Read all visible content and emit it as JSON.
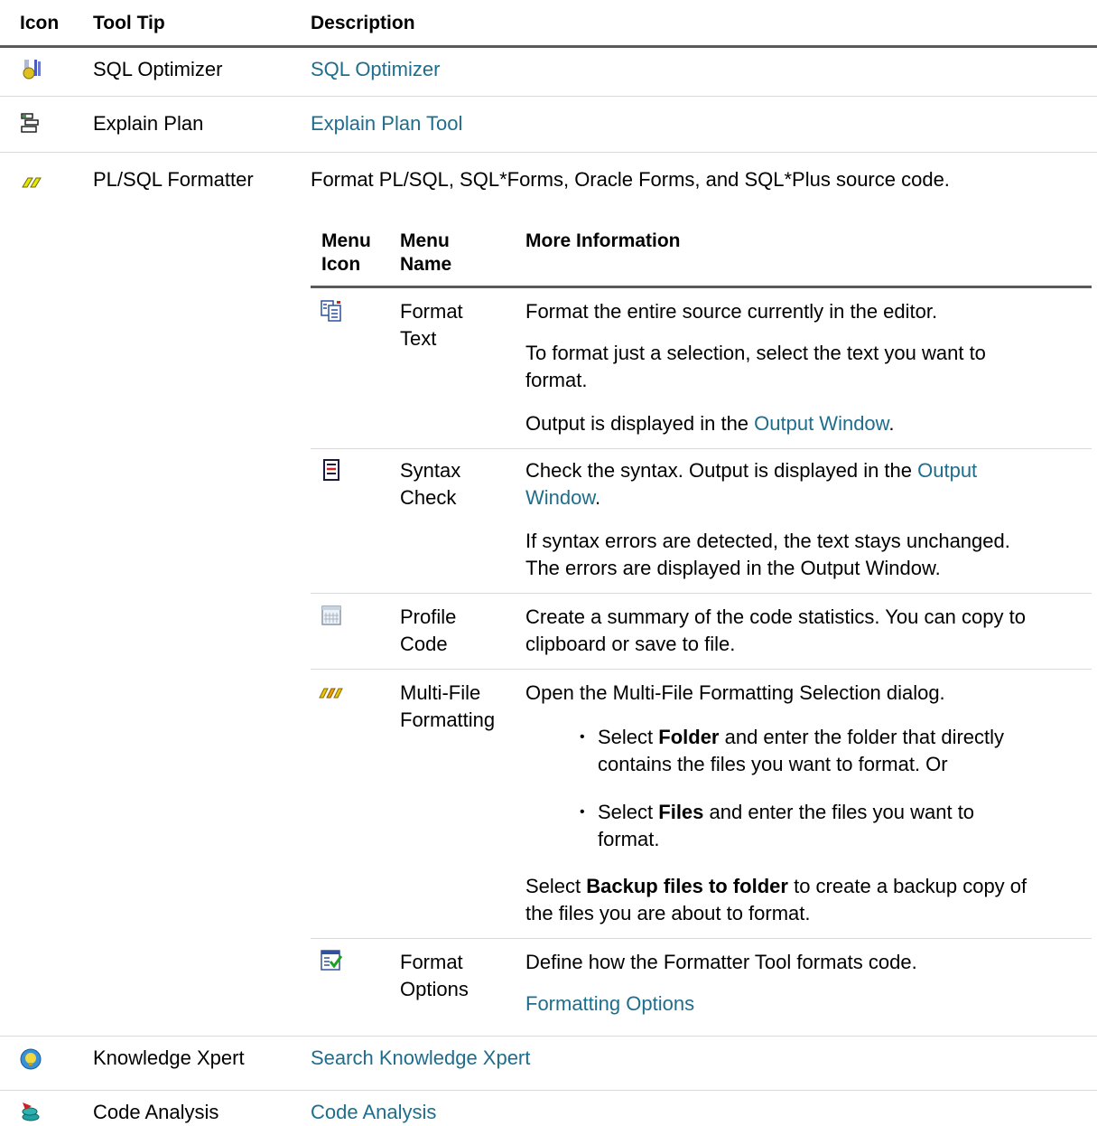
{
  "headers": {
    "icon": "Icon",
    "tooltip": "Tool Tip",
    "description": "Description"
  },
  "rows": {
    "sql_optimizer": {
      "icon": "sql-optimizer-icon",
      "tooltip": "SQL Optimizer",
      "description": "SQL Optimizer"
    },
    "explain_plan": {
      "icon": "explain-plan-icon",
      "tooltip": "Explain Plan",
      "description": "Explain Plan Tool"
    },
    "formatter": {
      "icon": "formatter-icon",
      "tooltip": "PL/SQL Formatter",
      "description": "Format PL/SQL, SQL*Forms, Oracle Forms, and SQL*Plus source code."
    },
    "knowledge": {
      "icon": "knowledge-xpert-icon",
      "tooltip": "Knowledge Xpert",
      "description": "Search Knowledge Xpert"
    },
    "code_analysis": {
      "icon": "code-analysis-icon",
      "tooltip": "Code Analysis",
      "description": "Code Analysis"
    }
  },
  "nested": {
    "headers": {
      "icon_1": "Menu",
      "icon_2": "Icon",
      "name_1": "Menu",
      "name_2": "Name",
      "info": "More Information"
    },
    "format_text": {
      "name_1": "Format",
      "name_2": "Text",
      "p1": "Format the entire source currently in the editor.",
      "p2a": "To format just a selection, select the text you want to",
      "p2b": "format.",
      "p3_pre": "Output is displayed in the ",
      "p3_link": "Output Window",
      "p3_post": "."
    },
    "syntax_check": {
      "name_1": "Syntax",
      "name_2": "Check",
      "p1a_pre": "Check the syntax. Output is displayed in the ",
      "p1a_link": "Output",
      "p1b_link": "Window",
      "p1b_post": ".",
      "p2a": "If syntax errors are detected, the text stays unchanged.",
      "p2b": "The errors are displayed in the Output Window."
    },
    "profile_code": {
      "name_1": "Profile",
      "name_2": "Code",
      "p1a": "Create a summary of the code statistics. You can copy to",
      "p1b": "clipboard or save to file."
    },
    "multi_file": {
      "name_1": "Multi-File",
      "name_2": "Formatting",
      "p1": "Open the Multi-File Formatting Selection dialog.",
      "b1_pre": "Select ",
      "b1_bold": "Folder",
      "b1_post": " and enter the folder that directly",
      "b1_line2": "contains the files you want to format. Or",
      "b2_pre": "Select ",
      "b2_bold": "Files",
      "b2_post": " and enter the files you want to",
      "b2_line2": "format.",
      "p2_pre": "Select ",
      "p2_bold": "Backup files to folder",
      "p2_post": " to create a backup copy of",
      "p2_line2": "the files you are about to format."
    },
    "format_options": {
      "name_1": "Format",
      "name_2": "Options",
      "p1": "Define how the Formatter Tool formats code.",
      "p2_link": "Formatting Options"
    }
  }
}
